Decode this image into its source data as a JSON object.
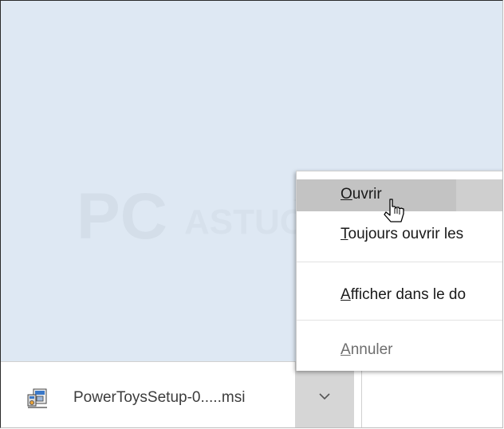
{
  "watermark": {
    "text_primary": "PC",
    "text_secondary": "ASTUCES"
  },
  "download": {
    "file_name": "PowerToysSetup-0.....msi",
    "icon": "msi-installer-icon",
    "chevron_icon": "chevron-down-icon"
  },
  "context_menu": {
    "items": [
      {
        "label_accel": "O",
        "label_rest": "uvrir",
        "state": "hover"
      },
      {
        "label_accel": "T",
        "label_rest": "oujours ouvrir les",
        "state": "normal"
      },
      {
        "label_accel": "A",
        "label_rest": "fficher dans le do",
        "state": "normal"
      },
      {
        "label_accel": "A",
        "label_rest": "nnuler",
        "state": "disabled"
      }
    ]
  },
  "colors": {
    "page_bg": "#dee8f3",
    "menu_hover": "#cfcfcf",
    "chevron_button": "#d6d6d6"
  }
}
